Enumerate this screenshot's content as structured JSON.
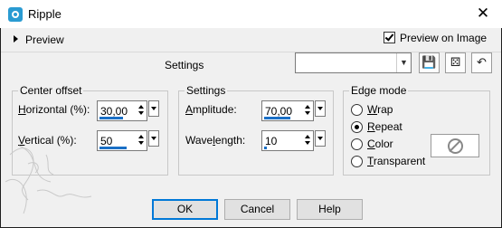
{
  "window": {
    "title": "Ripple",
    "close_label": "✕"
  },
  "preview": {
    "label": "Preview",
    "preview_on_image_label": "Preview on Image",
    "preview_on_image_checked": true
  },
  "settings_bar": {
    "label": "Settings",
    "preset_value": ""
  },
  "center_offset": {
    "title": "Center offset",
    "horizontal": {
      "label_mnemonic": "H",
      "label_rest": "orizontal (%):",
      "value": "30,00",
      "fill_fraction": 0.65
    },
    "vertical": {
      "label_mnemonic": "V",
      "label_rest": "ertical (%):",
      "value": "50",
      "fill_fraction": 0.75
    }
  },
  "settings": {
    "title": "Settings",
    "amplitude": {
      "label_mnemonic": "A",
      "label_rest": "mplitude:",
      "value": "70,00",
      "fill_fraction": 0.7
    },
    "wavelength": {
      "label_pre": "Wave",
      "label_mnemonic": "l",
      "label_rest": "ength:",
      "value": "10",
      "fill_fraction": 0.08
    }
  },
  "edge_mode": {
    "title": "Edge mode",
    "options": [
      {
        "mnemonic": "W",
        "rest": "rap",
        "checked": false
      },
      {
        "mnemonic": "R",
        "rest": "epeat",
        "checked": true
      },
      {
        "mnemonic": "C",
        "rest": "olor",
        "checked": false
      },
      {
        "mnemonic": "T",
        "rest": "ransparent",
        "checked": false
      }
    ]
  },
  "buttons": {
    "ok": "OK",
    "cancel": "Cancel",
    "help": "Help"
  },
  "icons": {
    "app": "ripple-app-icon",
    "save": "save-icon",
    "randomize": "dice-icon",
    "reset": "reset-icon",
    "no_color": "no-sign-icon"
  },
  "colors": {
    "accent": "#0078d7",
    "slider_fill": "#1a6fc6",
    "dialog_bg": "#f0f0f0"
  }
}
